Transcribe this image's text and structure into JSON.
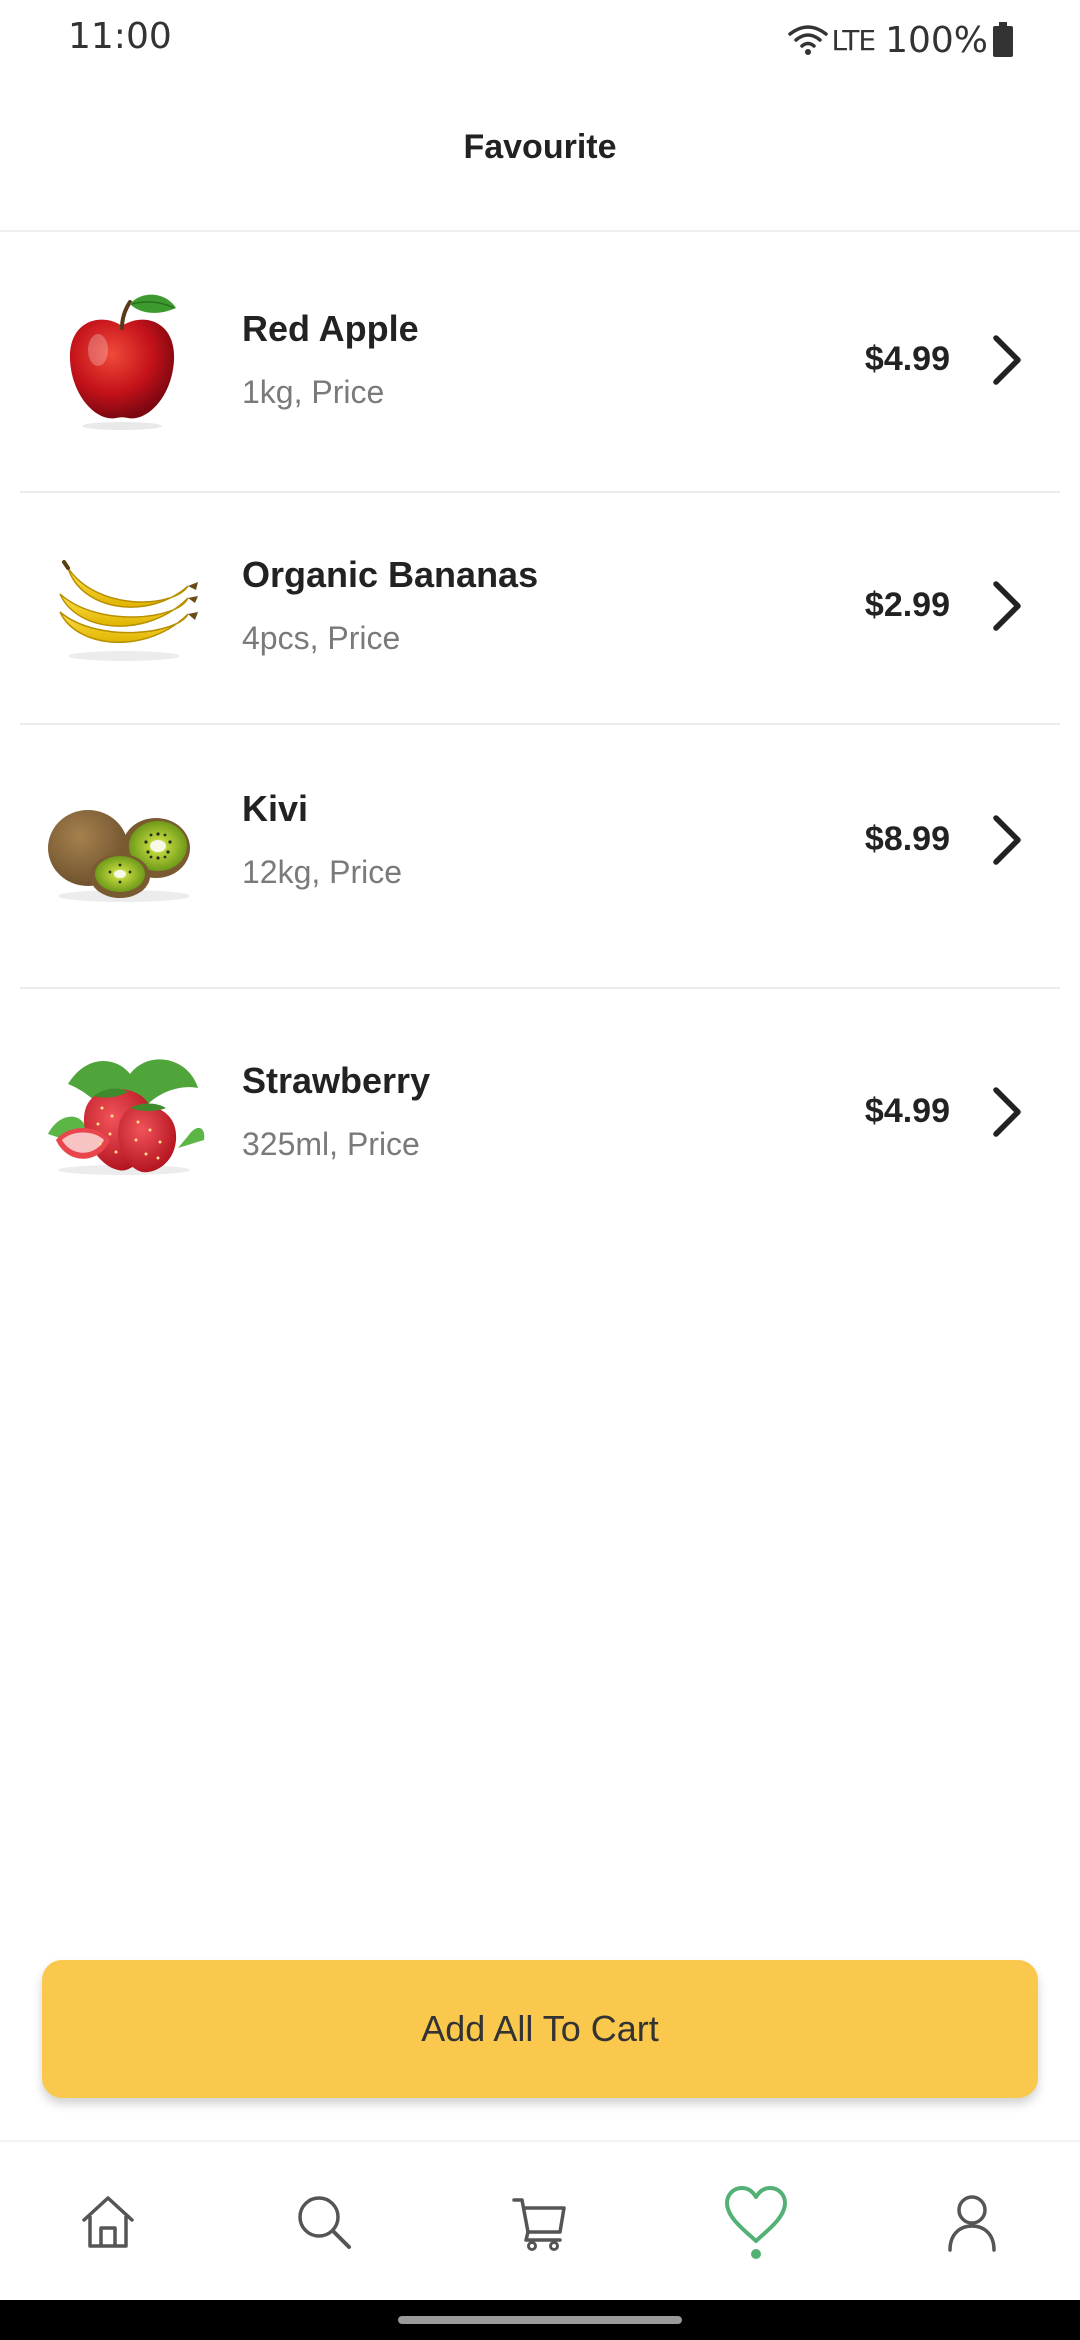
{
  "status_bar": {
    "time": "11:00",
    "network": "LTE",
    "battery": "100%"
  },
  "header": {
    "title": "Favourite"
  },
  "favourites": [
    {
      "name": "Red Apple",
      "detail": "1kg, Price",
      "price": "$4.99",
      "image": "apple"
    },
    {
      "name": "Organic Bananas",
      "detail": "4pcs, Price",
      "price": "$2.99",
      "image": "banana"
    },
    {
      "name": "Kivi",
      "detail": "12kg, Price",
      "price": "$8.99",
      "image": "kiwi"
    },
    {
      "name": "Strawberry",
      "detail": "325ml, Price",
      "price": "$4.99",
      "image": "strawberry"
    }
  ],
  "add_all_button": {
    "label": "Add All To Cart",
    "color": "#f9c84c"
  },
  "bottom_nav": {
    "items": [
      {
        "id": "shop",
        "icon": "home-icon",
        "active": false
      },
      {
        "id": "explore",
        "icon": "search-icon",
        "active": false
      },
      {
        "id": "cart",
        "icon": "cart-icon",
        "active": false
      },
      {
        "id": "favourite",
        "icon": "heart-icon",
        "active": true
      },
      {
        "id": "account",
        "icon": "user-icon",
        "active": false
      }
    ],
    "active_color": "#53b175",
    "inactive_color": "#555555"
  }
}
